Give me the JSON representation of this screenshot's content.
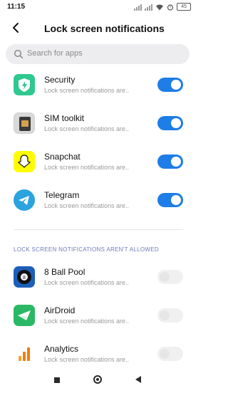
{
  "status_bar": {
    "time": "11:15",
    "battery": "45"
  },
  "header": {
    "title": "Lock screen notifications"
  },
  "search": {
    "placeholder": "Search for apps"
  },
  "allowed_apps": [
    {
      "name": "Security",
      "subtitle": "Lock screen notifications are..",
      "enabled": true,
      "icon": "shield-icon"
    },
    {
      "name": "SIM toolkit",
      "subtitle": "Lock screen notifications are..",
      "enabled": true,
      "icon": "sim-icon"
    },
    {
      "name": "Snapchat",
      "subtitle": "Lock screen notifications are..",
      "enabled": true,
      "icon": "snapchat-icon"
    },
    {
      "name": "Telegram",
      "subtitle": "Lock screen notifications are..",
      "enabled": true,
      "icon": "telegram-icon"
    }
  ],
  "section_title": "LOCK SCREEN NOTIFICATIONS AREN'T ALLOWED",
  "not_allowed_apps": [
    {
      "name": "8 Ball Pool",
      "subtitle": "Lock screen notifications are..",
      "enabled": false,
      "icon": "8-ball-icon"
    },
    {
      "name": "AirDroid",
      "subtitle": "Lock screen notifications are..",
      "enabled": false,
      "icon": "airdroid-icon"
    },
    {
      "name": "Analytics",
      "subtitle": "Lock screen notifications are..",
      "enabled": false,
      "icon": "analytics-icon"
    }
  ],
  "colors": {
    "accent": "#1e7de6",
    "section": "#6d7bb8"
  }
}
